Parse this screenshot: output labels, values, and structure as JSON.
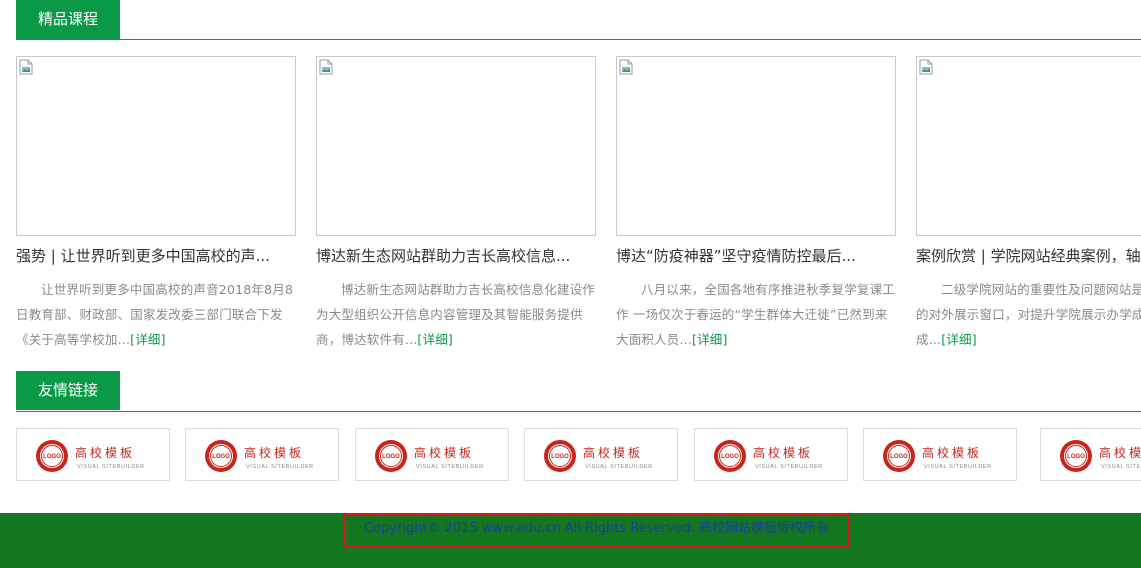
{
  "courses_section": {
    "title": "精品课程"
  },
  "courses": [
    {
      "title": "强势 | 让世界听到更多中国高校的声...",
      "desc": "让世界听到更多中国高校的声音2018年8月8日教育部、财政部、国家发改委三部门联合下发《关于高等学校加...",
      "more": "[详细]"
    },
    {
      "title": "博达新生态网站群助力吉长高校信息...",
      "desc": "博达新生态网站群助力吉长高校信息化建设作为大型组织公开信息内容管理及其智能服务提供商，博达软件有...",
      "more": "[详细]"
    },
    {
      "title": "博达“防疫神器”坚守疫情防控最后...",
      "desc": "八月以来，全国各地有序推进秋季复学复课工作 一场仅次于春运的“学生群体大迁徙”已然到来 大面积人员...",
      "more": "[详细]"
    },
    {
      "title": "案例欣赏 | 学院网站经典案例，轴",
      "desc": "二级学院网站的重要性及问题网站是学院重要的对外展示窗口，对提升学院展示办学成就和工作成...",
      "more": "[详细]"
    }
  ],
  "links_section": {
    "title": "友情链接"
  },
  "partner_logo": {
    "main_text": "高校模板",
    "sub_text": "VISUAL SITEBUILDER",
    "seal_text": "LOGO",
    "color": "#c8261c"
  },
  "footer": {
    "copyright": "Copyright© 2015 www.edu.cn All Rights Reserved. 高校网站模板版权所有"
  },
  "colors": {
    "brand_green": "#0a9a47",
    "footer_green": "#13771f",
    "highlight_red": "#e01515"
  }
}
